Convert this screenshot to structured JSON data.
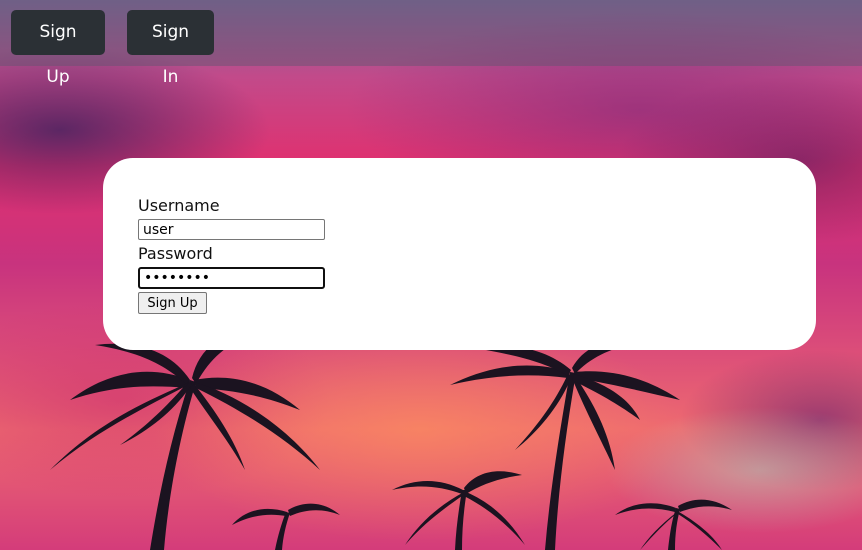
{
  "navbar": {
    "signup_label": "Sign Up",
    "signin_label": "Sign In"
  },
  "form": {
    "username_label": "Username",
    "username_value": "user",
    "password_label": "Password",
    "password_value": "••••••••",
    "submit_label": "Sign Up"
  },
  "colors": {
    "nav_button_bg": "#2b3035",
    "card_bg": "#ffffff"
  },
  "background": {
    "image": "sunset-palm-trees"
  }
}
